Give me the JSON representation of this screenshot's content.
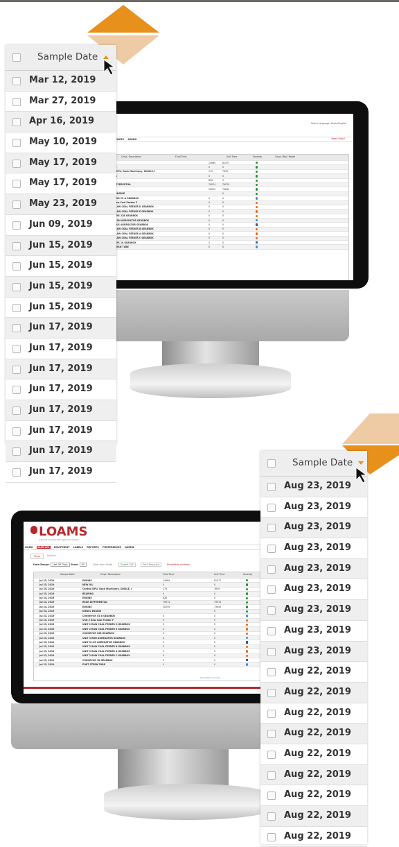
{
  "colors": {
    "accent": "#e8901c",
    "brand_red": "#b8262b",
    "header_bg": "#eeeeee"
  },
  "top_column": {
    "header": "Sample Date",
    "sort": "ascending",
    "dates": [
      "Mar 12, 2019",
      "Mar 27, 2019",
      "Apr 16, 2019",
      "May 10, 2019",
      "May 17, 2019",
      "May 17, 2019",
      "May 23, 2019",
      "Jun 09, 2019",
      "Jun 15, 2019",
      "Jun 15, 2019",
      "Jun 15, 2019",
      "Jun 15, 2019",
      "Jun 17, 2019",
      "Jun 17, 2019",
      "Jun 17, 2019",
      "Jun 17, 2019",
      "Jun 17, 2019",
      "Jun 17, 2019",
      "Jun 17, 2019",
      "Jun 17, 2019"
    ]
  },
  "bottom_column": {
    "header": "Sample Date",
    "sort": "descending",
    "dates": [
      "Aug 23, 2019",
      "Aug 23, 2019",
      "Aug 23, 2019",
      "Aug 23, 2019",
      "Aug 23, 2019",
      "Aug 23, 2019",
      "Aug 23, 2019",
      "Aug 23, 2019",
      "Aug 23, 2019",
      "Aug 22, 2019",
      "Aug 22, 2019",
      "Aug 22, 2019",
      "Aug 22, 2019",
      "Aug 22, 2019",
      "Aug 22, 2019",
      "Aug 22, 2019",
      "Aug 22, 2019",
      "Aug 22, 2019"
    ]
  },
  "app": {
    "logo": "LOAMS",
    "logo_subtitle": "Lube Oil Analysis Management System",
    "menu": [
      "HOME",
      "SAMPLES",
      "EQUIPMENT",
      "LABELS",
      "REPORTS",
      "PREFERENCES",
      "ADMIN"
    ],
    "tabs": [
      "View",
      "Deploy"
    ],
    "filters": {
      "date_range_label": "Date Range:",
      "date_range_value": "Last 90 Days",
      "show_label": "Show:",
      "show_value": "All",
      "clear_button": "Clear Item Order",
      "export_button": "Export XLS",
      "print_button": "Print Report(s)",
      "show_hide_button": "Show/Hide columns"
    },
    "columns": [
      "Sample Date",
      "Cmpt. Description",
      "Fluid Time",
      "Unit Time",
      "Severity",
      "Cmpt. Mfg / Model"
    ],
    "rows": [
      {
        "date": "Jul 25, 2019",
        "desc": "ENGINE",
        "fluid": "14989",
        "unit": "81577",
        "sev": "g"
      },
      {
        "date": "Jul 25, 2019",
        "desc": "NEW OIL",
        "fluid": "0",
        "unit": "0",
        "sev": "g"
      },
      {
        "date": "Jul 25, 2019",
        "desc": "Central DPU, Dock Machinery, SINGLE, I",
        "fluid": "179",
        "unit": "7639",
        "sev": "g"
      },
      {
        "date": "Jul 25, 2019",
        "desc": "BEARING",
        "fluid": "0",
        "unit": "0",
        "sev": "g"
      },
      {
        "date": "Jul 24, 2019",
        "desc": "ENGINE",
        "fluid": "826",
        "unit": "0",
        "sev": "g"
      },
      {
        "date": "Jul 24, 2019",
        "desc": "REAR DIFFERENTIAL",
        "fluid": "79074",
        "unit": "79074",
        "sev": "g"
      },
      {
        "date": "Jul 24, 2019",
        "desc": "ENGINE",
        "fluid": "30259",
        "unit": "73643",
        "sev": "g"
      },
      {
        "date": "Jul 24, 2019",
        "desc": "DIESEL ENGINE",
        "fluid": "",
        "unit": "0",
        "sev": "g"
      },
      {
        "date": "Jul 23, 2019",
        "desc": "CONVEYOR C5 A GEARBOX",
        "fluid": "0",
        "unit": "0",
        "sev": "b"
      },
      {
        "date": "Jul 23, 2019",
        "desc": "Unit 2 Raw Coal Feeder F",
        "fluid": "0",
        "unit": "0",
        "sev": "o"
      },
      {
        "date": "Jul 23, 2019",
        "desc": "UNIT 2 RAW COAL FEEDER D GEARBOX",
        "fluid": "0",
        "unit": "0",
        "sev": "o"
      },
      {
        "date": "Jul 23, 2019",
        "desc": "UNIT 2 RAW COAL FEEDER E GEARBOX",
        "fluid": "0",
        "unit": "0",
        "sev": "o"
      },
      {
        "date": "Jul 23, 2019",
        "desc": "CONVEYOR 22B GEARBOX",
        "fluid": "0",
        "unit": "0",
        "sev": "o"
      },
      {
        "date": "Jul 23, 2019",
        "desc": "UNIT 3 RDN AGREGATOR GEARBOX",
        "fluid": "0",
        "unit": "0",
        "sev": "b"
      },
      {
        "date": "Jul 23, 2019",
        "desc": "UNIT 3 LUS AGREGATOR GEARBOX",
        "fluid": "0",
        "unit": "0",
        "sev": "n"
      },
      {
        "date": "Jul 23, 2019",
        "desc": "UNIT 2 RAW COAL FEEDER B GEARBOX",
        "fluid": "0",
        "unit": "0",
        "sev": "o"
      },
      {
        "date": "Jul 23, 2019",
        "desc": "UNIT 3 RAW COAL FEEDER A GEARBOX",
        "fluid": "0",
        "unit": "0",
        "sev": "o"
      },
      {
        "date": "Jul 23, 2019",
        "desc": "UNIT 2 RAW COAL FEEDER C GEARBOX",
        "fluid": "0",
        "unit": "0",
        "sev": "o"
      },
      {
        "date": "Jul 23, 2019",
        "desc": "CONVEYOR 18 GEARBOX",
        "fluid": "0",
        "unit": "0",
        "sev": "n"
      },
      {
        "date": "Jul 23, 2019",
        "desc": "PORT STERN TUBE",
        "fluid": "0",
        "unit": "0",
        "sev": "b"
      }
    ],
    "show_more": "Show More records...",
    "select_language_label": "Select Language:",
    "language_value": "Select/English",
    "quick_search_placeholder": "Quick Search",
    "need_help": "Need Help?"
  }
}
